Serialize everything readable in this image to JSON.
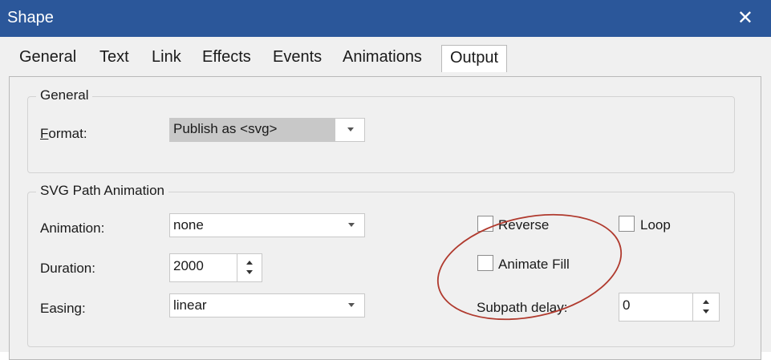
{
  "window": {
    "title": "Shape",
    "close_glyph": "✕"
  },
  "tabs": [
    {
      "label": "General"
    },
    {
      "label": "Text"
    },
    {
      "label": "Link"
    },
    {
      "label": "Effects"
    },
    {
      "label": "Events"
    },
    {
      "label": "Animations"
    },
    {
      "label": "Output",
      "active": true
    }
  ],
  "general_group": {
    "legend": "General",
    "format_label_prefix": "F",
    "format_label_rest": "ormat:",
    "format_value": "Publish as <svg>"
  },
  "svg_group": {
    "legend": "SVG Path Animation",
    "animation_label": "Animation:",
    "animation_value": "none",
    "duration_label": "Duration:",
    "duration_value": "2000",
    "easing_label": "Easing:",
    "easing_value": "linear",
    "reverse_label": "Reverse",
    "reverse_checked": false,
    "loop_label": "Loop",
    "loop_checked": false,
    "animate_fill_label": "Animate Fill",
    "animate_fill_checked": false,
    "subpath_delay_label": "Subpath delay:",
    "subpath_delay_value": "0"
  },
  "colors": {
    "titlebar": "#2b579a",
    "annotation": "#b03a2e"
  }
}
